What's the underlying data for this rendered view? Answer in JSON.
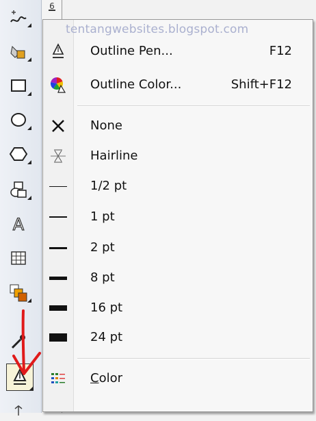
{
  "watermark": "tentangwebsites.blogspot.com",
  "ruler": {
    "label": "6"
  },
  "toolbox": {
    "tools": [
      {
        "name": "freehand-tool-icon"
      },
      {
        "name": "smart-fill-tool-icon"
      },
      {
        "name": "rectangle-tool-icon"
      },
      {
        "name": "ellipse-tool-icon"
      },
      {
        "name": "polygon-tool-icon"
      },
      {
        "name": "basic-shapes-tool-icon"
      },
      {
        "name": "text-tool-icon"
      },
      {
        "name": "table-tool-icon"
      },
      {
        "name": "interactive-tool-icon"
      },
      {
        "name": "eyedropper-tool-icon"
      },
      {
        "name": "outline-pen-tool-icon"
      }
    ]
  },
  "menu": {
    "outline_pen": {
      "label": "Outline Pen...",
      "shortcut": "F12"
    },
    "outline_color": {
      "label": "Outline Color...",
      "shortcut": "Shift+F12"
    },
    "widths": [
      {
        "label": "None"
      },
      {
        "label": "Hairline"
      },
      {
        "label": "1/2 pt"
      },
      {
        "label": "1 pt"
      },
      {
        "label": "2 pt"
      },
      {
        "label": "8 pt"
      },
      {
        "label": "16 pt"
      },
      {
        "label": "24 pt"
      }
    ],
    "color": {
      "label": "Color",
      "mnemonic": "C"
    }
  },
  "colors": {
    "annotation_arrow": "#e01a1a",
    "menu_background": "#f7f7f7",
    "active_tool_background": "#f7f3d8"
  }
}
